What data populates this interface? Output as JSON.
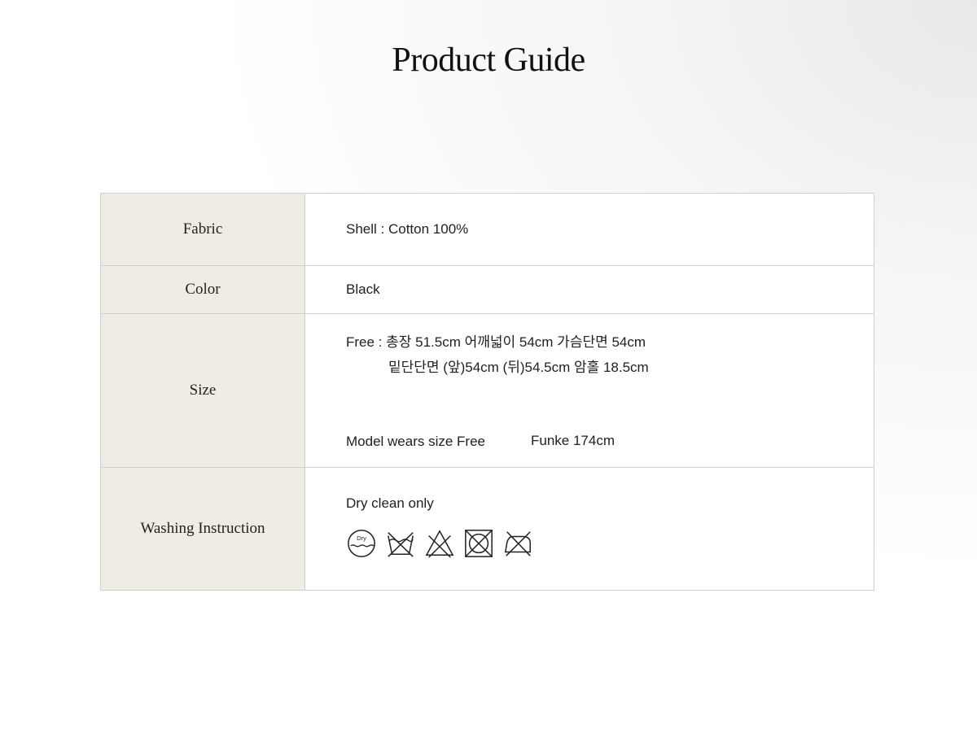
{
  "title": "Product Guide",
  "rows": {
    "fabric": {
      "label": "Fabric",
      "value": "Shell : Cotton 100%"
    },
    "color": {
      "label": "Color",
      "value": "Black"
    },
    "size": {
      "label": "Size",
      "line1": "Free : 총장 51.5cm 어깨넓이 54cm 가슴단면 54cm",
      "line2": "밑단단면 (앞)54cm (뒤)54.5cm 암홀 18.5cm",
      "model": "Model wears size Free",
      "model_name": "Funke 174cm"
    },
    "washing": {
      "label": "Washing Instruction",
      "text": "Dry clean only",
      "dry_badge": "Dry",
      "icons": [
        "dry-clean-icon",
        "no-washing-icon",
        "no-bleach-icon",
        "no-tumble-dry-icon",
        "no-ironing-icon"
      ]
    }
  }
}
